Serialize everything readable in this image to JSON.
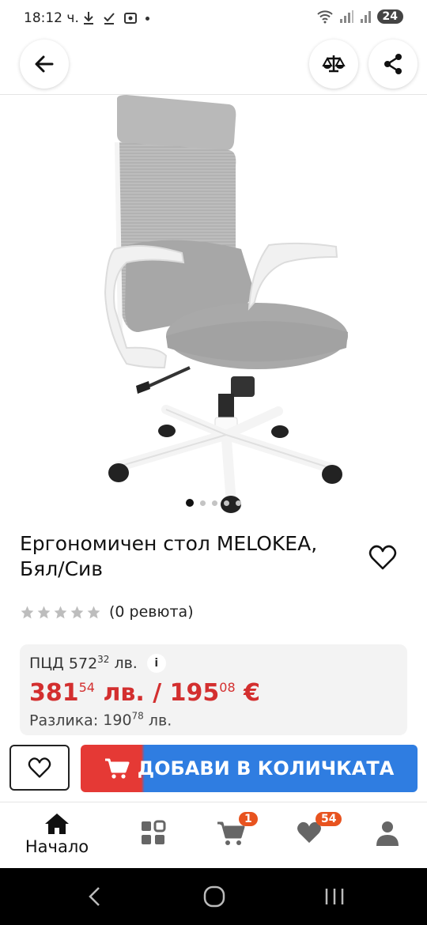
{
  "status_bar": {
    "time": "18:12 ч.",
    "battery": "24"
  },
  "product": {
    "title": "Ергономичен стол MELOKEA, Бял/Сив",
    "rating_count_label": "(0 ревюта)",
    "rating_value": 0,
    "image_count": 5,
    "active_image": 1
  },
  "pricing": {
    "pcd_label": "ПЦД",
    "pcd_int": "572",
    "pcd_dec": "32",
    "pcd_currency": "лв.",
    "info_icon": "i",
    "price_bgn_int": "381",
    "price_bgn_dec": "54",
    "price_bgn_currency": "лв.",
    "separator": "/",
    "price_eur_int": "195",
    "price_eur_dec": "08",
    "price_eur_currency": "€",
    "diff_label": "Разлика:",
    "diff_int": "190",
    "diff_dec": "78",
    "diff_currency": "лв."
  },
  "actions": {
    "add_to_cart": "ДОБАВИ В КОЛИЧКАТА"
  },
  "bottom_nav": {
    "home_label": "Начало",
    "cart_badge": "1",
    "favorites_badge": "54"
  },
  "colors": {
    "accent_red": "#e53935",
    "accent_blue": "#2f7de1",
    "price_red": "#d32f2f",
    "badge_orange": "#e8531f"
  }
}
